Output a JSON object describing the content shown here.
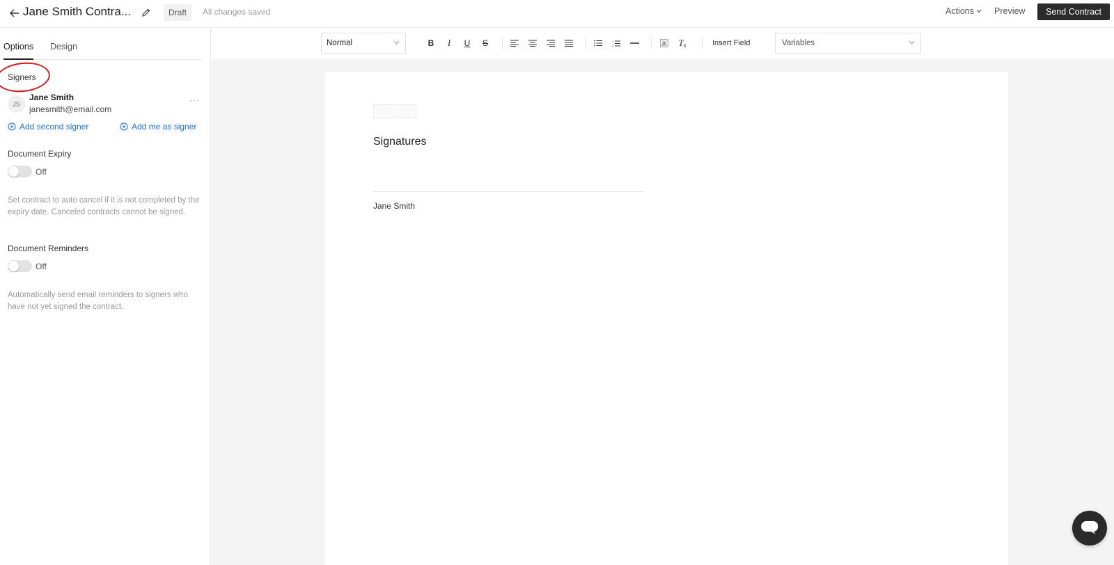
{
  "header": {
    "back_icon": "arrow-left-icon",
    "title": "Jane Smith Contra...",
    "edit_icon": "pencil-icon",
    "status_badge": "Draft",
    "save_status": "All changes saved",
    "actions_label": "Actions",
    "preview_label": "Preview",
    "send_label": "Send Contract"
  },
  "sidebar": {
    "tabs": [
      {
        "label": "Options",
        "active": true
      },
      {
        "label": "Design",
        "active": false
      }
    ],
    "signers": {
      "label": "Signers",
      "list": [
        {
          "initials": "JS",
          "name": "Jane Smith",
          "email": "janesmith@email.com",
          "more": "···"
        }
      ],
      "add_second": "Add second signer",
      "add_me": "Add me as signer"
    },
    "expiry": {
      "label": "Document Expiry",
      "state": "Off",
      "help": "Set contract to auto cancel if it is not completed by the expiry date. Canceled contracts cannot be signed."
    },
    "reminders": {
      "label": "Document Reminders",
      "state": "Off",
      "help": "Automatically send email reminders to signers who have not yet signed the contract."
    }
  },
  "toolbar": {
    "style_select": "Normal",
    "buttons": [
      "bold-icon",
      "italic-icon",
      "underline-icon",
      "strikethrough-icon",
      "align-left-icon",
      "align-center-icon",
      "align-right-icon",
      "align-justify-icon",
      "bullet-list-icon",
      "numbered-list-icon",
      "horizontal-rule-icon",
      "text-color-icon",
      "clear-format-icon"
    ],
    "insert_field": "Insert Field",
    "variables_select": "Variables"
  },
  "document": {
    "heading": "Signatures",
    "signer_name": "Jane Smith"
  },
  "colors": {
    "accent_link": "#1a73c7",
    "primary_button": "#2b2b2b",
    "annotation": "#d01e1e"
  }
}
